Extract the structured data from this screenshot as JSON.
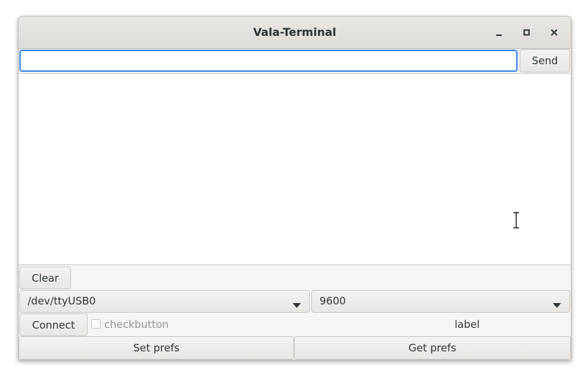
{
  "window": {
    "title": "Vala-Terminal"
  },
  "titlebar": {
    "minimize_icon": "minimize-icon",
    "maximize_icon": "maximize-icon",
    "close_icon": "close-icon"
  },
  "command": {
    "value": "",
    "send_label": "Send"
  },
  "output": {
    "text": ""
  },
  "controls": {
    "clear_label": "Clear",
    "port_selected": "/dev/ttyUSB0",
    "baud_selected": "9600",
    "connect_label": "Connect",
    "checkbutton_label": "checkbutton",
    "checkbutton_checked": false,
    "status_label": "label",
    "set_prefs_label": "Set prefs",
    "get_prefs_label": "Get prefs"
  },
  "colors": {
    "focus_accent": "#3584e4",
    "text": "#2e3436",
    "disabled_text": "#929595"
  }
}
